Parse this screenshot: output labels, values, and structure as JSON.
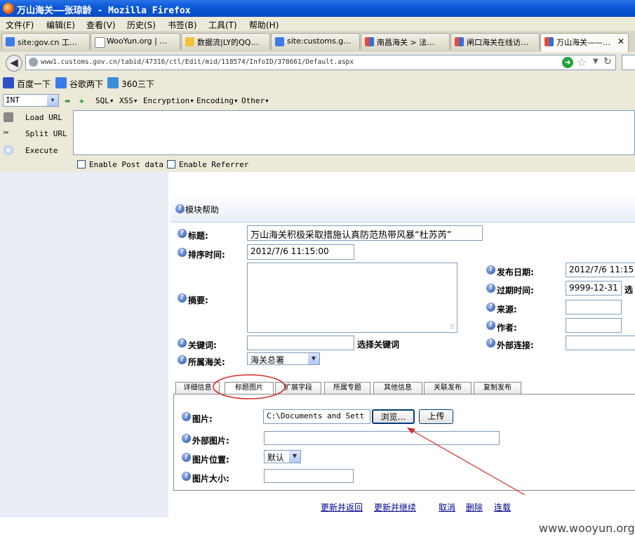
{
  "window": {
    "title": "万山海关——张琼龄 - Mozilla Firefox"
  },
  "menu": [
    "文件(F)",
    "编辑(E)",
    "查看(V)",
    "历史(S)",
    "书签(B)",
    "工具(T)",
    "帮助(H)"
  ],
  "browser_tabs": [
    {
      "label": "site:gov.cn 工…",
      "icon": "google-icon",
      "active": false
    },
    {
      "label": "WooYun.org | …",
      "icon": "page-icon",
      "active": false
    },
    {
      "label": "数据流|LY的QQ…",
      "icon": "star-folder-icon",
      "active": false
    },
    {
      "label": "site:customs.g…",
      "icon": "google-icon",
      "active": false
    },
    {
      "label": "南昌海关 > 法…",
      "icon": "cube-icon",
      "active": false
    },
    {
      "label": "闸口海关在线访…",
      "icon": "cube-icon",
      "active": false
    },
    {
      "label": "万山海关——…",
      "icon": "cube-icon",
      "active": true
    }
  ],
  "nav": {
    "url": "www1.customs.gov.cn/tabid/47316/ctl/Edit/mid/118574/InfoID/378661/Default.aspx"
  },
  "bookmarks": [
    "百度一下",
    "谷歌两下",
    "360三下"
  ],
  "hackbar": {
    "type_select": "INT",
    "menus": [
      "SQL▾",
      "XSS▾",
      "Encryption▾",
      "Encoding▾",
      "Other▾"
    ],
    "actions": [
      "Load URL",
      "Split URL",
      "Execute"
    ],
    "checkboxes": [
      "Enable Post data",
      "Enable Referrer"
    ]
  },
  "module": {
    "help_label": "模块帮助"
  },
  "form": {
    "title_label": "标题:",
    "title_value": "万山海关积极采取措施认真防范热带风暴“杜苏芮”",
    "sort_time_label": "排序时间:",
    "sort_time_value": "2012/7/6 11:15:00",
    "summary_label": "摘要:",
    "keyword_label": "关键词:",
    "keyword_link": "选择关键词",
    "customs_label": "所属海关:",
    "customs_value": "海关总署",
    "publish_date_label": "发布日期:",
    "publish_date_value": "2012/7/6 11:15",
    "expire_label": "过期时间:",
    "expire_value": "9999-12-31",
    "expire_select": "选",
    "source_label": "来源:",
    "author_label": "作者:",
    "external_link_label": "外部连接:"
  },
  "page_tabs": [
    "详细信息",
    "标题图片",
    "扩展字段",
    "所属专题",
    "其他信息",
    "关联发布",
    "复制发布"
  ],
  "picture": {
    "image_label": "图片:",
    "file_value": "C:\\Documents and Sett",
    "browse_button": "浏览…",
    "upload_button": "上传",
    "external_image_label": "外部图片:",
    "position_label": "图片位置:",
    "position_value": "默认",
    "size_label": "图片大小:"
  },
  "actions": [
    "更新并返回",
    "更新并继续",
    "取消",
    "删除",
    "连载"
  ],
  "watermark": "www.wooyun.org"
}
